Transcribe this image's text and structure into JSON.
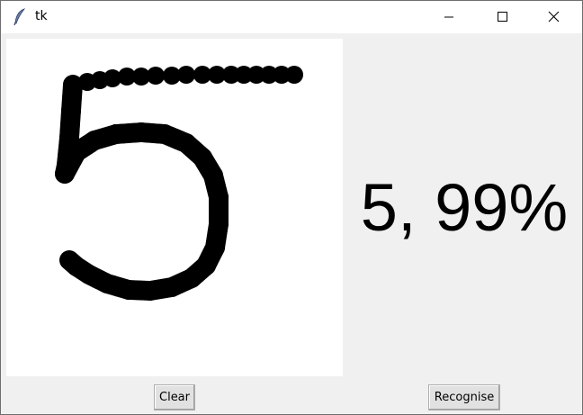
{
  "window": {
    "title": "tk",
    "app_icon": "feather-icon",
    "controls": [
      "minimize-icon",
      "maximize-icon",
      "close-icon"
    ]
  },
  "canvas": {
    "background": "#ffffff",
    "stroke_color": "#000000",
    "drawn_digit_icon": "handwritten-five"
  },
  "result": {
    "text": "5, 99%"
  },
  "buttons": {
    "clear_label": "Clear",
    "recognise_label": "Recognise"
  },
  "colors": {
    "window_bg": "#f0f0f0",
    "titlebar_bg": "#ffffff",
    "button_bg": "#e1e1e1",
    "button_border": "#adadad"
  }
}
